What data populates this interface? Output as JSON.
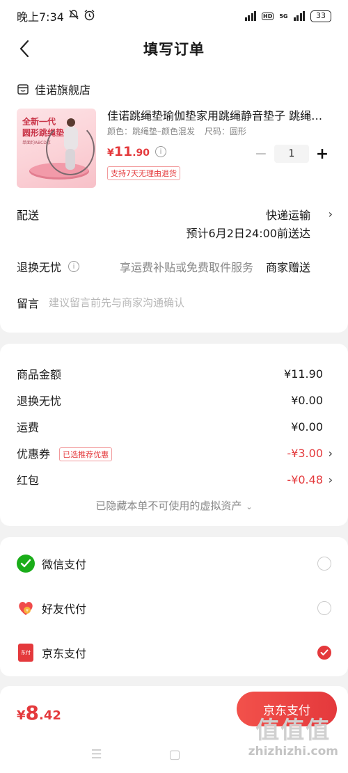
{
  "status": {
    "time": "晚上7:34",
    "network": "5G",
    "battery": "33"
  },
  "nav": {
    "title": "填写订单"
  },
  "shop": {
    "name": "佳诺旗舰店"
  },
  "product": {
    "thumb_line1": "全新一代",
    "thumb_line2": "圆形跳绳垫",
    "thumb_line3": "单面约ABCD厚",
    "title": "佳诺跳绳垫瑜伽垫家用跳绳静音垫子 跳绳…",
    "spec_color": "颜色：跳绳垫–颜色混发",
    "spec_size": "尺码：圆形",
    "price_symbol": "¥",
    "price_int": "11",
    "price_dec": ".90",
    "quantity": "1",
    "return_tag": "支持7天无理由退货"
  },
  "delivery": {
    "label": "配送",
    "method": "快递运输",
    "eta": "预计6月2日24:00前送达"
  },
  "refund": {
    "label": "退换无忧",
    "desc": "享运费补贴或免费取件服务",
    "value": "商家赠送"
  },
  "message": {
    "label": "留言",
    "placeholder": "建议留言前先与商家沟通确认"
  },
  "fees": [
    {
      "label": "商品金额",
      "value": "¥11.90"
    },
    {
      "label": "退换无忧",
      "value": "¥0.00"
    },
    {
      "label": "运费",
      "value": "¥0.00"
    },
    {
      "label": "优惠券",
      "tag": "已选推荐优惠",
      "value": "-¥3.00"
    },
    {
      "label": "红包",
      "value": "-¥0.48"
    }
  ],
  "hidden_assets": "已隐藏本单不可使用的虚拟资产",
  "payments": [
    {
      "label": "微信支付",
      "selected": false
    },
    {
      "label": "好友代付",
      "selected": false
    },
    {
      "label": "京东支付",
      "selected": true
    }
  ],
  "pay_icon_text": "东付",
  "total": {
    "symbol": "¥",
    "int": "8",
    "dec": ".42"
  },
  "pay_button": "京东支付",
  "watermark": {
    "big": "值值值",
    "small": "zhizhizhi.com"
  },
  "colors": {
    "accent": "#e4393c",
    "wechat": "#1aad19"
  }
}
